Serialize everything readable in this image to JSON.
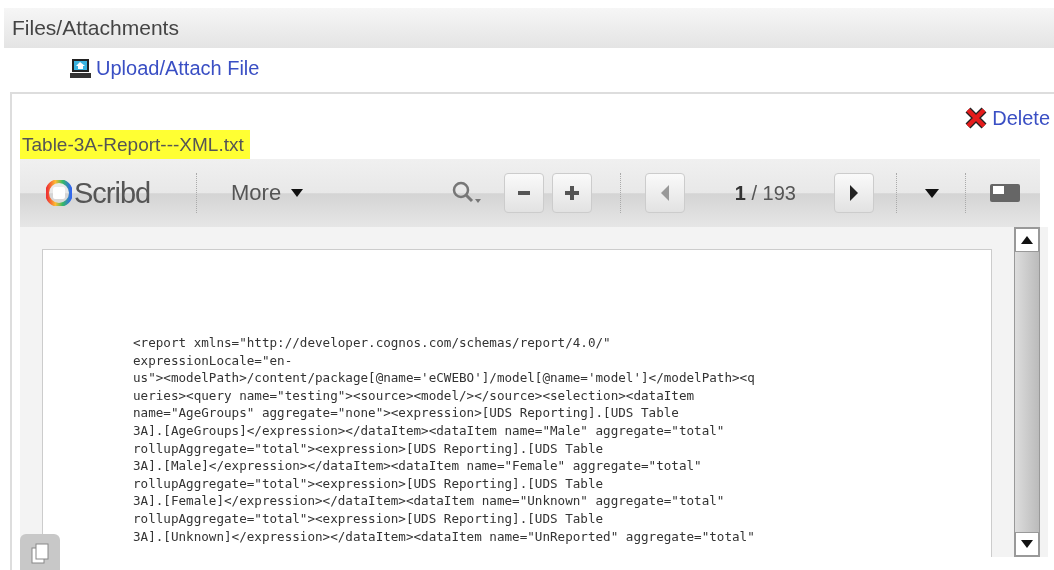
{
  "section": {
    "title": "Files/Attachments"
  },
  "upload_link": {
    "label": "Upload/Attach File"
  },
  "attachment": {
    "delete_label": "Delete",
    "filename": "Table-3A-Report---XML.txt",
    "viewer": {
      "logo": "Scribd",
      "more_label": "More",
      "page_indicator": "**1** / 193",
      "lines": [
        "<report xmlns=\"http://developer.cognos.com/schemas/report/4.0/\"",
        "expressionLocale=\"en-",
        "us\"><modelPath>/content/package[@name='eCWEBO']/model[@name='model']</modelPath><q",
        "ueries><query name=\"testing\"><source><model/></source><selection><dataItem",
        "name=\"AgeGroups\" aggregate=\"none\"><expression>[UDS Reporting].[UDS Table",
        "3A].[AgeGroups]</expression></dataItem><dataItem name=\"Male\" aggregate=\"total\"",
        "rollupAggregate=\"total\"><expression>[UDS Reporting].[UDS Table",
        "3A].[Male]</expression></dataItem><dataItem name=\"Female\" aggregate=\"total\"",
        "rollupAggregate=\"total\"><expression>[UDS Reporting].[UDS Table",
        "3A].[Female]</expression></dataItem><dataItem name=\"Unknown\" aggregate=\"total\"",
        "rollupAggregate=\"total\"><expression>[UDS Reporting].[UDS Table",
        "3A].[Unknown]</expression></dataItem><dataItem name=\"UnReported\" aggregate=\"total\""
      ]
    }
  }
}
